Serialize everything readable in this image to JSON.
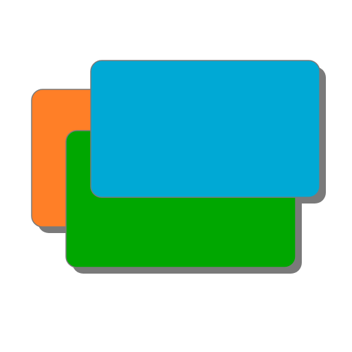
{
  "colors": {
    "background": "#ffffff",
    "orange_card": "#ff7f27",
    "green_card": "#00a700",
    "blue_card": "#00a9d5",
    "shadow": "#7a7a7a",
    "outline": "#7a7a7a"
  },
  "icon": "stacked-windows-icon"
}
